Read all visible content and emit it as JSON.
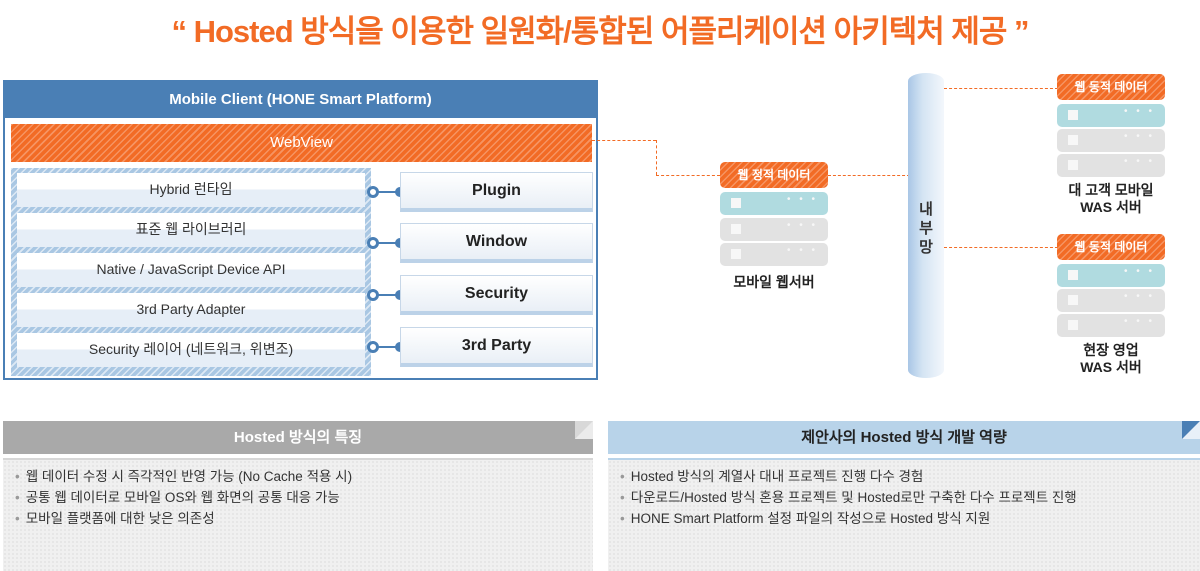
{
  "title": "“ Hosted 방식을 이용한 일원화/통합된 어플리케이션 아키텍처 제공 ”",
  "client": {
    "header": "Mobile Client (HONE Smart Platform)",
    "webview": "WebView",
    "layers": [
      "Hybrid 런타임",
      "표준 웹 라이브러리",
      "Native / JavaScript Device API",
      "3rd Party Adapter",
      "Security 레이어 (네트워크, 위변조)"
    ],
    "extensions": [
      "Plugin",
      "Window",
      "Security",
      "3rd Party"
    ]
  },
  "web_server": {
    "label": "웹 정적 데이터",
    "name": "모바일 웹서버"
  },
  "network": {
    "label_chars": [
      "내",
      "부",
      "망"
    ]
  },
  "was_servers": [
    {
      "label": "웹 동적 데이터",
      "name_line1": "대 고객  모바일",
      "name_line2": "WAS 서버"
    },
    {
      "label": "웹 동적 데이터",
      "name_line1": "현장 영업",
      "name_line2": "WAS 서버"
    }
  ],
  "server_unit_dots": "• • •",
  "panels": {
    "features": {
      "title": "Hosted 방식의 특징",
      "items": [
        "웹 데이터 수정 시 즉각적인 반영 가능 (No Cache 적용 시)",
        "공통 웹 데이터로 모바일 OS와 웹 화면의 공통 대응 가능",
        "모바일 플랫폼에 대한 낮은 의존성"
      ]
    },
    "capability": {
      "title": "제안사의 Hosted 방식 개발 역량",
      "items": [
        "Hosted 방식의 계열사 대내 프로젝트 진행 다수 경험",
        "다운로드/Hosted 방식 혼용 프로젝트 및 Hosted로만 구축한 다수 프로젝트 진행",
        "HONE Smart Platform  설정 파일의 작성으로 Hosted 방식 지원"
      ]
    },
    "bullet": "•"
  },
  "colors": {
    "accent_orange": "#f26b25",
    "client_blue": "#4a7fb5",
    "panel_gray": "#a9a9a9",
    "panel_blue": "#b8d3e9",
    "server_active": "#b0dbe0",
    "server_idle": "#e2e2e2"
  }
}
